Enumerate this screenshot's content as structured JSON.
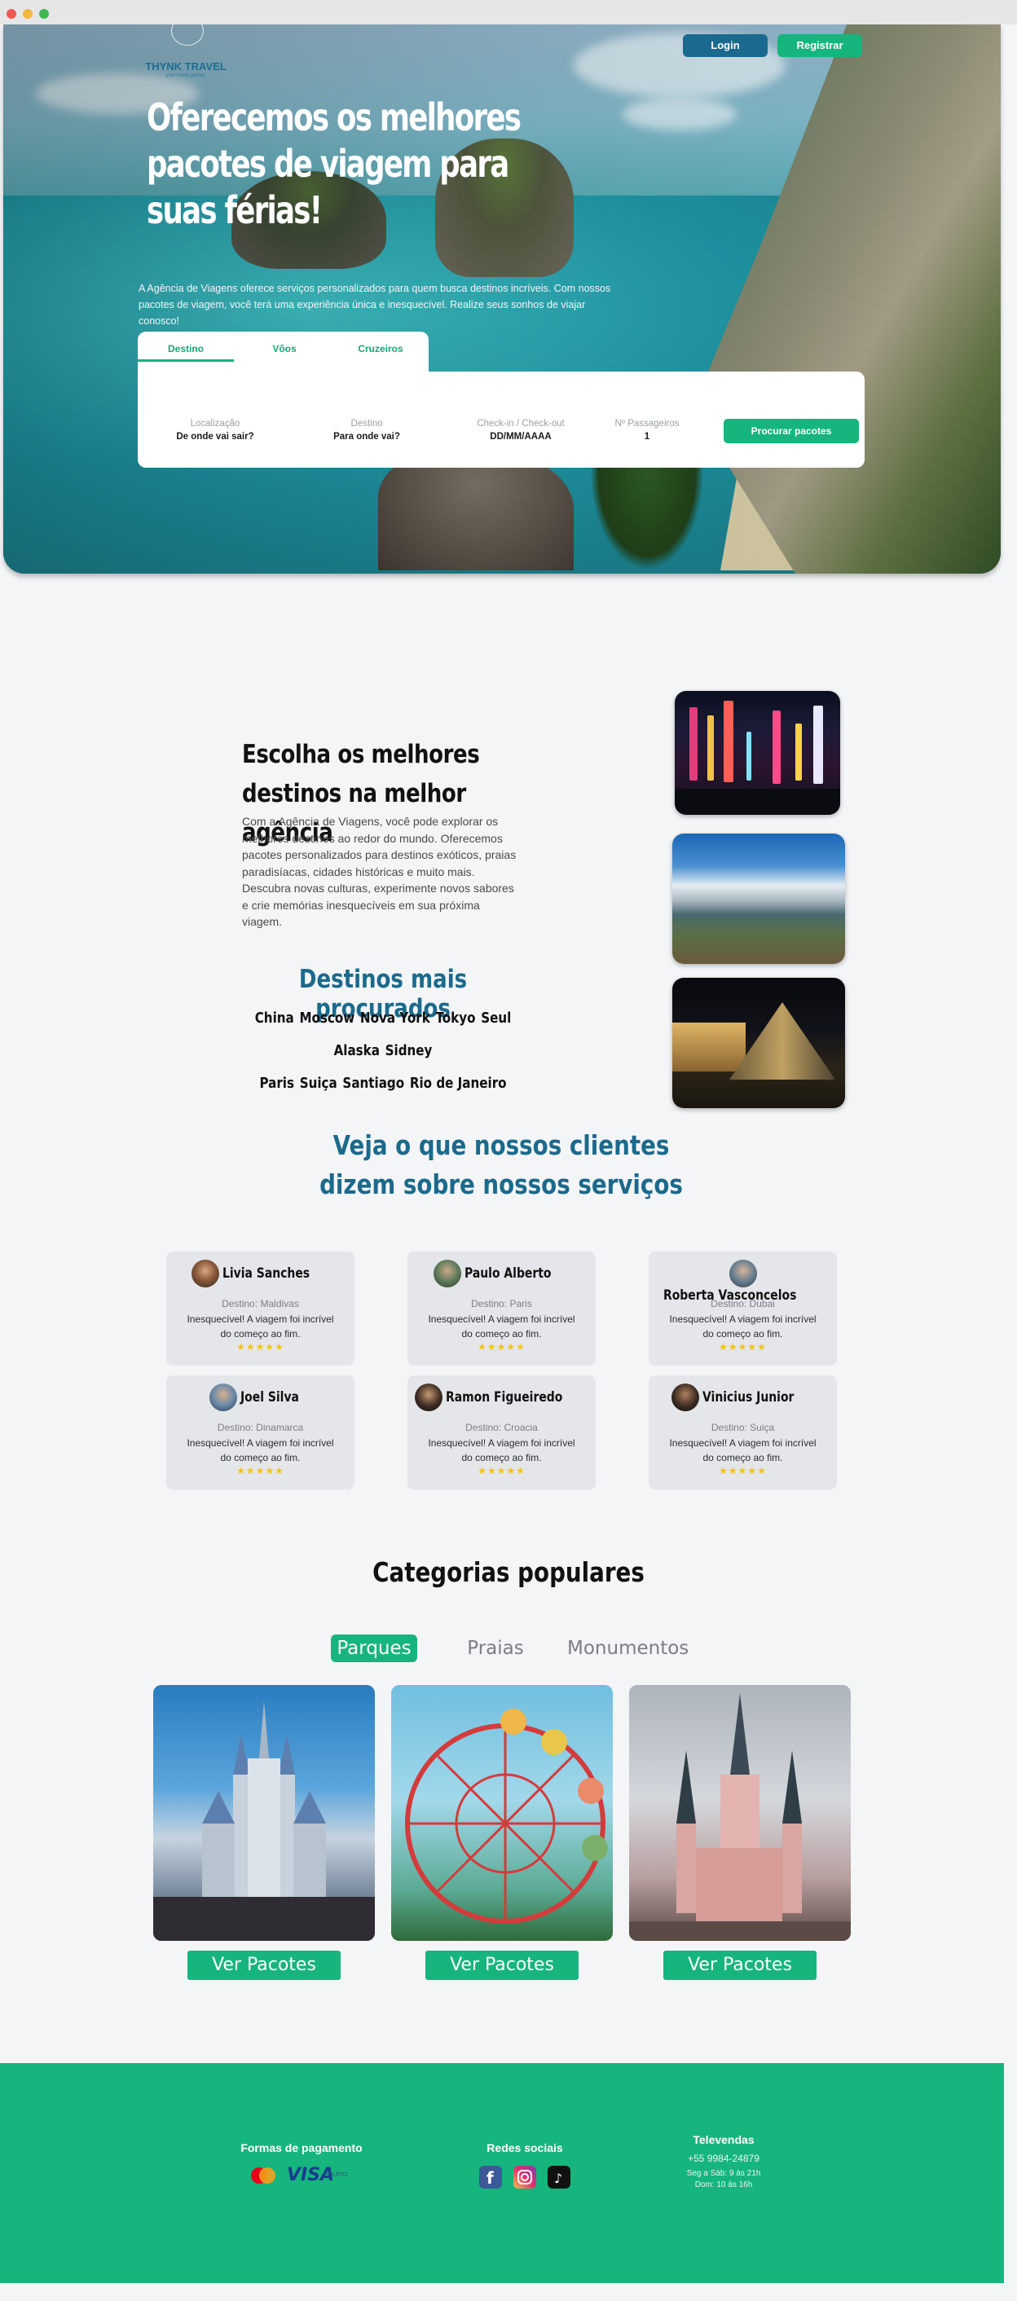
{
  "brand": {
    "name": "THYNK TRAVEL",
    "tagline": "your travel partner"
  },
  "header": {
    "login_label": "Login",
    "register_label": "Registrar"
  },
  "hero": {
    "title": "Oferecemos os melhores pacotes de viagem para suas férias!",
    "description": "A Agência de Viagens oferece serviços personalizados para quem busca destinos incríveis. Com nossos pacotes de viagem, você terá uma experiência única e inesquecível. Realize seus sonhos de viajar conosco!"
  },
  "search": {
    "tabs": [
      "Destino",
      "Vôos",
      "Cruzeiros"
    ],
    "active_tab": "Destino",
    "fields": [
      {
        "label": "Localização",
        "value": "De onde vai sair?"
      },
      {
        "label": "Destino",
        "value": "Para onde vai?"
      },
      {
        "label": "Check-in / Check-out",
        "value": "DD/MM/AAAA"
      },
      {
        "label": "Nº Passageiros",
        "value": "1"
      }
    ],
    "button_label": "Procurar pacotes"
  },
  "destinations": {
    "title": "Escolha os melhores destinos na melhor agência",
    "text": "Com a Agência de Viagens, você pode explorar os melhores destinos ao redor do mundo. Oferecemos pacotes personalizados para destinos exóticos, praias paradisíacas, cidades históricas e muito mais. Descubra novas culturas, experimente novos sabores e crie memórias inesquecíveis em sua próxima viagem.",
    "popular_title": "Destinos mais procurados",
    "popular": [
      "China",
      "Moscow",
      "Nova York",
      "Tokyo",
      "Seul",
      "Alaska",
      "Sidney",
      "Paris",
      "Suiça",
      "Santiago",
      "Rio de Janeiro"
    ]
  },
  "testimonials": {
    "title": "Veja o que nossos clientes dizem sobre nossos serviços",
    "items": [
      {
        "name": "Livia Sanches",
        "destination": "Destino: Maldivas",
        "text": "Inesquecível! A viagem foi incrível do começo ao fim.",
        "stars": "★★★★★"
      },
      {
        "name": "Paulo Alberto",
        "destination": "Destino: Paris",
        "text": "Inesquecível! A viagem foi incrível do começo ao fim.",
        "stars": "★★★★★"
      },
      {
        "name": "Roberta Vasconcelos",
        "destination": "Destino: Dubai",
        "text": "Inesquecível! A viagem foi incrível do começo ao fim.",
        "stars": "★★★★★"
      },
      {
        "name": "Joel Silva",
        "destination": "Destino: Dinamarca",
        "text": "Inesquecível! A viagem foi incrível do começo ao fim.",
        "stars": "★★★★★"
      },
      {
        "name": "Ramon Figueiredo",
        "destination": "Destino: Croacia",
        "text": "Inesquecível! A viagem foi incrível do começo ao fim.",
        "stars": "★★★★★"
      },
      {
        "name": "Vinicius Junior",
        "destination": "Destino: Suiça",
        "text": "Inesquecível! A viagem foi incrível do começo ao fim.",
        "stars": "★★★★★"
      }
    ]
  },
  "categories": {
    "title": "Categorias populares",
    "tabs": [
      "Parques",
      "Praias",
      "Monumentos"
    ],
    "active_tab": "Parques",
    "button_label": "Ver Pacotes"
  },
  "footer": {
    "payment_title": "Formas de pagamento",
    "payment_methods": [
      "mastercard",
      "VISA",
      "BOLETO"
    ],
    "social_title": "Redes sociais",
    "social": [
      "facebook-icon",
      "instagram-icon",
      "tiktok-icon"
    ],
    "contact_title": "Televendas",
    "phone": "+55 9984-24879",
    "hours_week": "Seg a Sáb: 9 às 21h",
    "hours_sun": "Dom: 10 às 16h"
  },
  "colors": {
    "primary_green": "#16b57d",
    "primary_blue": "#1a6a90",
    "page_bg": "#f4f5f7"
  }
}
